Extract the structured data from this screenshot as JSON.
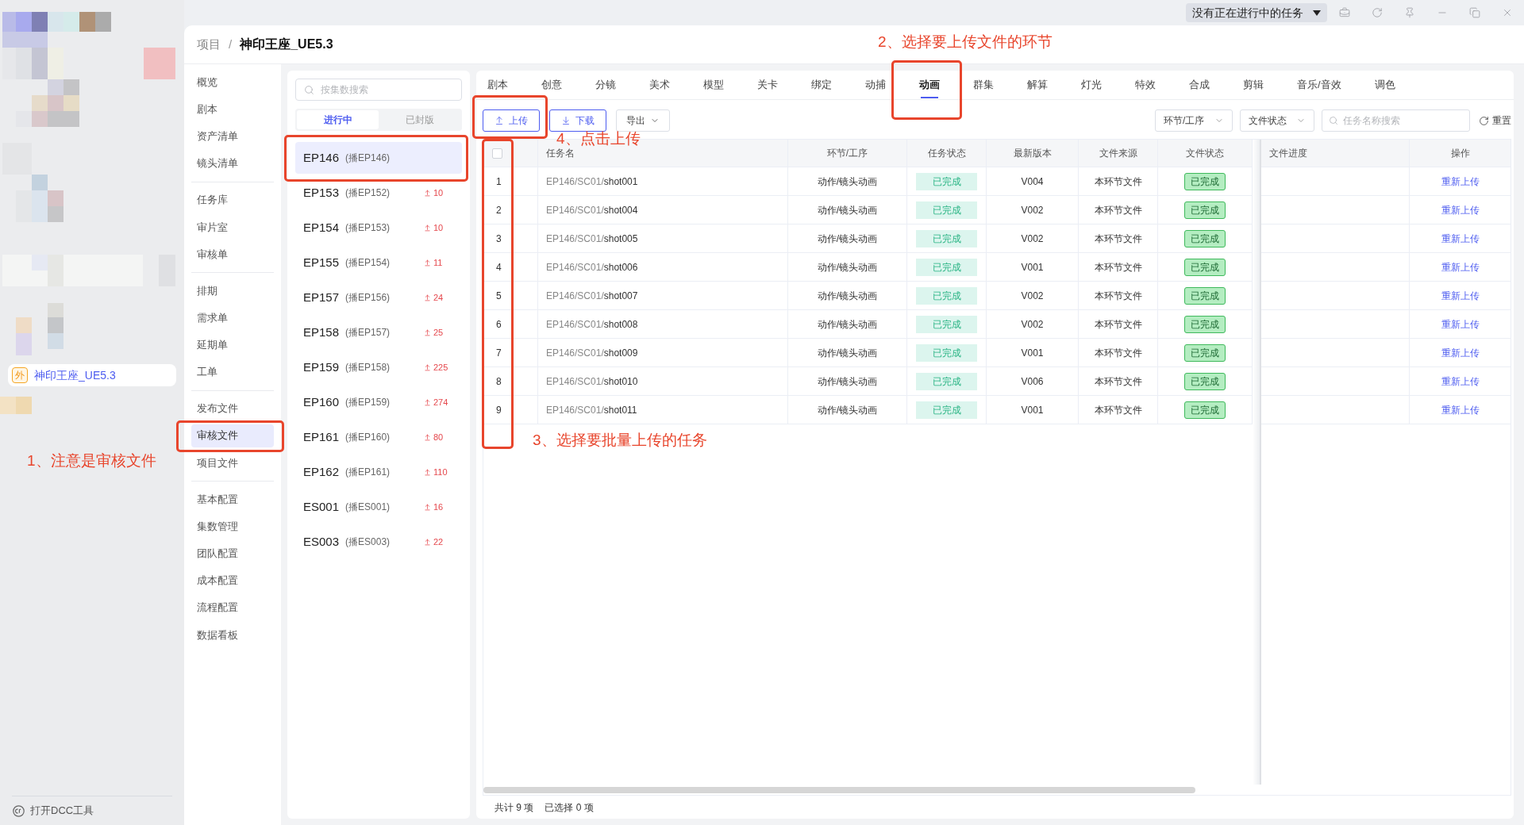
{
  "title_bar": {
    "task_menu": "没有正在进行中的任务"
  },
  "rail": {
    "project": {
      "badge": "外",
      "name": "神印王座_UE5.3",
      "selected": true
    },
    "dcc_tool": "打开DCC工具"
  },
  "breadcrumb": {
    "items": [
      "项目",
      "神印王座_UE5.3"
    ],
    "separator": "/"
  },
  "nav": {
    "groups": [
      [
        {
          "label": "概览",
          "selected": false,
          "frame": false
        },
        {
          "label": "剧本",
          "selected": false,
          "frame": false
        },
        {
          "label": "资产清单",
          "selected": false,
          "frame": false
        },
        {
          "label": "镜头清单",
          "selected": false,
          "frame": false
        }
      ],
      [
        {
          "label": "任务库",
          "selected": false,
          "frame": false
        },
        {
          "label": "审片室",
          "selected": false,
          "frame": false
        },
        {
          "label": "审核单",
          "selected": false,
          "frame": false
        }
      ],
      [
        {
          "label": "排期",
          "selected": false,
          "frame": false
        },
        {
          "label": "需求单",
          "selected": false,
          "frame": false
        },
        {
          "label": "延期单",
          "selected": false,
          "frame": false
        },
        {
          "label": "工单",
          "selected": false,
          "frame": false
        }
      ],
      [
        {
          "label": "发布文件",
          "selected": false,
          "frame": false
        },
        {
          "label": "审核文件",
          "selected": true,
          "frame": true,
          "note": "1、注意是审核文件"
        },
        {
          "label": "项目文件",
          "selected": false,
          "frame": false
        }
      ],
      [
        {
          "label": "基本配置",
          "selected": false,
          "frame": false
        },
        {
          "label": "集数管理",
          "selected": false,
          "frame": false
        },
        {
          "label": "团队配置",
          "selected": false,
          "frame": false
        },
        {
          "label": "成本配置",
          "selected": false,
          "frame": false
        },
        {
          "label": "流程配置",
          "selected": false,
          "frame": false
        },
        {
          "label": "数据看板",
          "selected": false,
          "frame": false
        }
      ]
    ]
  },
  "episodes": {
    "search": {
      "placeholder": "按集数搜索"
    },
    "filters": [
      {
        "label": "进行中",
        "selected": true
      },
      {
        "label": "已封版",
        "selected": false
      }
    ],
    "items": [
      {
        "code": "EP146",
        "alias": "(播EP146)",
        "selected": true,
        "frame": true
      },
      {
        "code": "EP153",
        "alias": "(播EP152)",
        "count": "10",
        "selected": false,
        "frame": false
      },
      {
        "code": "EP154",
        "alias": "(播EP153)",
        "count": "10",
        "selected": false,
        "frame": false
      },
      {
        "code": "EP155",
        "alias": "(播EP154)",
        "count": "11",
        "selected": false,
        "frame": false
      },
      {
        "code": "EP157",
        "alias": "(播EP156)",
        "count": "24",
        "selected": false,
        "frame": false
      },
      {
        "code": "EP158",
        "alias": "(播EP157)",
        "count": "25",
        "selected": false,
        "frame": false
      },
      {
        "code": "EP159",
        "alias": "(播EP158)",
        "count": "225",
        "selected": false,
        "frame": false
      },
      {
        "code": "EP160",
        "alias": "(播EP159)",
        "count": "274",
        "selected": false,
        "frame": false
      },
      {
        "code": "EP161",
        "alias": "(播EP160)",
        "count": "80",
        "selected": false,
        "frame": false
      },
      {
        "code": "EP162",
        "alias": "(播EP161)",
        "count": "110",
        "selected": false,
        "frame": false
      },
      {
        "code": "ES001",
        "alias": "(播ES001)",
        "count": "16",
        "selected": false,
        "frame": false
      },
      {
        "code": "ES003",
        "alias": "(播ES003)",
        "count": "22",
        "selected": false,
        "frame": false
      }
    ]
  },
  "stage_tabs": [
    {
      "label": "剧本",
      "selected": false,
      "frame": false
    },
    {
      "label": "创意",
      "selected": false,
      "frame": false
    },
    {
      "label": "分镜",
      "selected": false,
      "frame": false
    },
    {
      "label": "美术",
      "selected": false,
      "frame": false
    },
    {
      "label": "模型",
      "selected": false,
      "frame": false
    },
    {
      "label": "关卡",
      "selected": false,
      "frame": false
    },
    {
      "label": "绑定",
      "selected": false,
      "frame": false
    },
    {
      "label": "动捕",
      "selected": false,
      "frame": false
    },
    {
      "label": "动画",
      "selected": true,
      "frame": true,
      "note": "2、选择要上传文件的环节"
    },
    {
      "label": "群集",
      "selected": false,
      "frame": false
    },
    {
      "label": "解算",
      "selected": false,
      "frame": false
    },
    {
      "label": "灯光",
      "selected": false,
      "frame": false
    },
    {
      "label": "特效",
      "selected": false,
      "frame": false
    },
    {
      "label": "合成",
      "selected": false,
      "frame": false
    },
    {
      "label": "剪辑",
      "selected": false,
      "frame": false
    },
    {
      "label": "音乐/音效",
      "selected": false,
      "frame": false
    },
    {
      "label": "调色",
      "selected": false,
      "frame": false
    }
  ],
  "toolbar": {
    "actions": [
      {
        "kind": "upload",
        "label": "上传",
        "frame": true,
        "note": "4、点击上传"
      },
      {
        "kind": "download",
        "label": "下载",
        "frame": false
      },
      {
        "kind": "menu",
        "label": "导出",
        "frame": false
      }
    ],
    "filters": [
      {
        "label": "环节/工序"
      },
      {
        "label": "文件状态"
      }
    ],
    "search": {
      "placeholder": "任务名称搜索"
    },
    "reset": "重置"
  },
  "table": {
    "select_all": {
      "checked": false
    },
    "index_frame": true,
    "index_note": "3、选择要批量上传的任务",
    "columns": [
      "任务名",
      "环节/工序",
      "任务状态",
      "最新版本",
      "文件来源",
      "文件状态",
      "文件进度",
      "操作"
    ],
    "rows": [
      {
        "index": "1",
        "path": "EP146/SC01/",
        "shot": "shot001",
        "stage": "动作/镜头动画",
        "task_status": "已完成",
        "version": "V004",
        "source": "本环节文件",
        "file_status": "已完成",
        "action": "重新上传"
      },
      {
        "index": "2",
        "path": "EP146/SC01/",
        "shot": "shot004",
        "stage": "动作/镜头动画",
        "task_status": "已完成",
        "version": "V002",
        "source": "本环节文件",
        "file_status": "已完成",
        "action": "重新上传"
      },
      {
        "index": "3",
        "path": "EP146/SC01/",
        "shot": "shot005",
        "stage": "动作/镜头动画",
        "task_status": "已完成",
        "version": "V002",
        "source": "本环节文件",
        "file_status": "已完成",
        "action": "重新上传"
      },
      {
        "index": "4",
        "path": "EP146/SC01/",
        "shot": "shot006",
        "stage": "动作/镜头动画",
        "task_status": "已完成",
        "version": "V001",
        "source": "本环节文件",
        "file_status": "已完成",
        "action": "重新上传"
      },
      {
        "index": "5",
        "path": "EP146/SC01/",
        "shot": "shot007",
        "stage": "动作/镜头动画",
        "task_status": "已完成",
        "version": "V002",
        "source": "本环节文件",
        "file_status": "已完成",
        "action": "重新上传"
      },
      {
        "index": "6",
        "path": "EP146/SC01/",
        "shot": "shot008",
        "stage": "动作/镜头动画",
        "task_status": "已完成",
        "version": "V002",
        "source": "本环节文件",
        "file_status": "已完成",
        "action": "重新上传"
      },
      {
        "index": "7",
        "path": "EP146/SC01/",
        "shot": "shot009",
        "stage": "动作/镜头动画",
        "task_status": "已完成",
        "version": "V001",
        "source": "本环节文件",
        "file_status": "已完成",
        "action": "重新上传"
      },
      {
        "index": "8",
        "path": "EP146/SC01/",
        "shot": "shot010",
        "stage": "动作/镜头动画",
        "task_status": "已完成",
        "version": "V006",
        "source": "本环节文件",
        "file_status": "已完成",
        "action": "重新上传"
      },
      {
        "index": "9",
        "path": "EP146/SC01/",
        "shot": "shot011",
        "stage": "动作/镜头动画",
        "task_status": "已完成",
        "version": "V001",
        "source": "本环节文件",
        "file_status": "已完成",
        "action": "重新上传"
      }
    ]
  },
  "footer": {
    "total": "共计 9 项",
    "selected_count": "已选择 0 项"
  }
}
